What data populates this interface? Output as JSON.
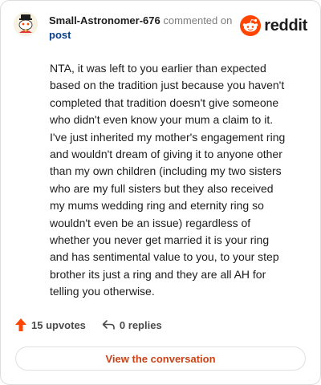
{
  "header": {
    "username": "Small-Astronomer-676",
    "action_text": "commented on",
    "target_link": "post"
  },
  "brand": {
    "name": "reddit",
    "accent_color": "#ff4500"
  },
  "comment": {
    "body": "NTA, it was left to you earlier than expected based on the tradition just because you haven't completed that tradition doesn't give someone who didn't even know your mum a claim to it. I've just inherited my mother's engagement ring and wouldn't dream of giving it to anyone other than my own children (including my two sisters who are my full sisters but they also received my mums wedding ring and eternity ring so wouldn't even be an issue) regardless of whether you never get married it is your ring and has sentimental value to you, to your step brother its just a ring and they are all AH for telling you otherwise."
  },
  "actions": {
    "upvotes_label": "15 upvotes",
    "replies_label": "0 replies"
  },
  "footer": {
    "view_button_label": "View the conversation"
  },
  "icons": {
    "upvote": "arrow-up-icon",
    "reply": "reply-arrow-icon",
    "brand": "reddit-snoo-icon",
    "avatar": "snoo-avatar-icon"
  }
}
